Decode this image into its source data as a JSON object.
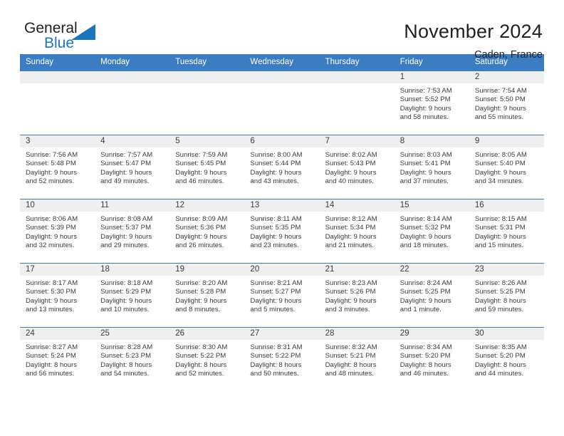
{
  "logo": {
    "word_top": "General",
    "word_bottom": "Blue",
    "accent_color": "#1b75bb"
  },
  "header": {
    "title": "November 2024",
    "location": "Caden, France"
  },
  "calendar": {
    "header_color": "#3b7dc0",
    "daynum_band_color": "#efefef",
    "weekday_headers": [
      "Sunday",
      "Monday",
      "Tuesday",
      "Wednesday",
      "Thursday",
      "Friday",
      "Saturday"
    ],
    "weeks": [
      [
        null,
        null,
        null,
        null,
        null,
        {
          "day": "1",
          "sunrise": "Sunrise: 7:53 AM",
          "sunset": "Sunset: 5:52 PM",
          "daylight_1": "Daylight: 9 hours",
          "daylight_2": "and 58 minutes."
        },
        {
          "day": "2",
          "sunrise": "Sunrise: 7:54 AM",
          "sunset": "Sunset: 5:50 PM",
          "daylight_1": "Daylight: 9 hours",
          "daylight_2": "and 55 minutes."
        }
      ],
      [
        {
          "day": "3",
          "sunrise": "Sunrise: 7:56 AM",
          "sunset": "Sunset: 5:48 PM",
          "daylight_1": "Daylight: 9 hours",
          "daylight_2": "and 52 minutes."
        },
        {
          "day": "4",
          "sunrise": "Sunrise: 7:57 AM",
          "sunset": "Sunset: 5:47 PM",
          "daylight_1": "Daylight: 9 hours",
          "daylight_2": "and 49 minutes."
        },
        {
          "day": "5",
          "sunrise": "Sunrise: 7:59 AM",
          "sunset": "Sunset: 5:45 PM",
          "daylight_1": "Daylight: 9 hours",
          "daylight_2": "and 46 minutes."
        },
        {
          "day": "6",
          "sunrise": "Sunrise: 8:00 AM",
          "sunset": "Sunset: 5:44 PM",
          "daylight_1": "Daylight: 9 hours",
          "daylight_2": "and 43 minutes."
        },
        {
          "day": "7",
          "sunrise": "Sunrise: 8:02 AM",
          "sunset": "Sunset: 5:43 PM",
          "daylight_1": "Daylight: 9 hours",
          "daylight_2": "and 40 minutes."
        },
        {
          "day": "8",
          "sunrise": "Sunrise: 8:03 AM",
          "sunset": "Sunset: 5:41 PM",
          "daylight_1": "Daylight: 9 hours",
          "daylight_2": "and 37 minutes."
        },
        {
          "day": "9",
          "sunrise": "Sunrise: 8:05 AM",
          "sunset": "Sunset: 5:40 PM",
          "daylight_1": "Daylight: 9 hours",
          "daylight_2": "and 34 minutes."
        }
      ],
      [
        {
          "day": "10",
          "sunrise": "Sunrise: 8:06 AM",
          "sunset": "Sunset: 5:39 PM",
          "daylight_1": "Daylight: 9 hours",
          "daylight_2": "and 32 minutes."
        },
        {
          "day": "11",
          "sunrise": "Sunrise: 8:08 AM",
          "sunset": "Sunset: 5:37 PM",
          "daylight_1": "Daylight: 9 hours",
          "daylight_2": "and 29 minutes."
        },
        {
          "day": "12",
          "sunrise": "Sunrise: 8:09 AM",
          "sunset": "Sunset: 5:36 PM",
          "daylight_1": "Daylight: 9 hours",
          "daylight_2": "and 26 minutes."
        },
        {
          "day": "13",
          "sunrise": "Sunrise: 8:11 AM",
          "sunset": "Sunset: 5:35 PM",
          "daylight_1": "Daylight: 9 hours",
          "daylight_2": "and 23 minutes."
        },
        {
          "day": "14",
          "sunrise": "Sunrise: 8:12 AM",
          "sunset": "Sunset: 5:34 PM",
          "daylight_1": "Daylight: 9 hours",
          "daylight_2": "and 21 minutes."
        },
        {
          "day": "15",
          "sunrise": "Sunrise: 8:14 AM",
          "sunset": "Sunset: 5:32 PM",
          "daylight_1": "Daylight: 9 hours",
          "daylight_2": "and 18 minutes."
        },
        {
          "day": "16",
          "sunrise": "Sunrise: 8:15 AM",
          "sunset": "Sunset: 5:31 PM",
          "daylight_1": "Daylight: 9 hours",
          "daylight_2": "and 15 minutes."
        }
      ],
      [
        {
          "day": "17",
          "sunrise": "Sunrise: 8:17 AM",
          "sunset": "Sunset: 5:30 PM",
          "daylight_1": "Daylight: 9 hours",
          "daylight_2": "and 13 minutes."
        },
        {
          "day": "18",
          "sunrise": "Sunrise: 8:18 AM",
          "sunset": "Sunset: 5:29 PM",
          "daylight_1": "Daylight: 9 hours",
          "daylight_2": "and 10 minutes."
        },
        {
          "day": "19",
          "sunrise": "Sunrise: 8:20 AM",
          "sunset": "Sunset: 5:28 PM",
          "daylight_1": "Daylight: 9 hours",
          "daylight_2": "and 8 minutes."
        },
        {
          "day": "20",
          "sunrise": "Sunrise: 8:21 AM",
          "sunset": "Sunset: 5:27 PM",
          "daylight_1": "Daylight: 9 hours",
          "daylight_2": "and 5 minutes."
        },
        {
          "day": "21",
          "sunrise": "Sunrise: 8:23 AM",
          "sunset": "Sunset: 5:26 PM",
          "daylight_1": "Daylight: 9 hours",
          "daylight_2": "and 3 minutes."
        },
        {
          "day": "22",
          "sunrise": "Sunrise: 8:24 AM",
          "sunset": "Sunset: 5:25 PM",
          "daylight_1": "Daylight: 9 hours",
          "daylight_2": "and 1 minute."
        },
        {
          "day": "23",
          "sunrise": "Sunrise: 8:26 AM",
          "sunset": "Sunset: 5:25 PM",
          "daylight_1": "Daylight: 8 hours",
          "daylight_2": "and 59 minutes."
        }
      ],
      [
        {
          "day": "24",
          "sunrise": "Sunrise: 8:27 AM",
          "sunset": "Sunset: 5:24 PM",
          "daylight_1": "Daylight: 8 hours",
          "daylight_2": "and 56 minutes."
        },
        {
          "day": "25",
          "sunrise": "Sunrise: 8:28 AM",
          "sunset": "Sunset: 5:23 PM",
          "daylight_1": "Daylight: 8 hours",
          "daylight_2": "and 54 minutes."
        },
        {
          "day": "26",
          "sunrise": "Sunrise: 8:30 AM",
          "sunset": "Sunset: 5:22 PM",
          "daylight_1": "Daylight: 8 hours",
          "daylight_2": "and 52 minutes."
        },
        {
          "day": "27",
          "sunrise": "Sunrise: 8:31 AM",
          "sunset": "Sunset: 5:22 PM",
          "daylight_1": "Daylight: 8 hours",
          "daylight_2": "and 50 minutes."
        },
        {
          "day": "28",
          "sunrise": "Sunrise: 8:32 AM",
          "sunset": "Sunset: 5:21 PM",
          "daylight_1": "Daylight: 8 hours",
          "daylight_2": "and 48 minutes."
        },
        {
          "day": "29",
          "sunrise": "Sunrise: 8:34 AM",
          "sunset": "Sunset: 5:20 PM",
          "daylight_1": "Daylight: 8 hours",
          "daylight_2": "and 46 minutes."
        },
        {
          "day": "30",
          "sunrise": "Sunrise: 8:35 AM",
          "sunset": "Sunset: 5:20 PM",
          "daylight_1": "Daylight: 8 hours",
          "daylight_2": "and 44 minutes."
        }
      ]
    ]
  }
}
